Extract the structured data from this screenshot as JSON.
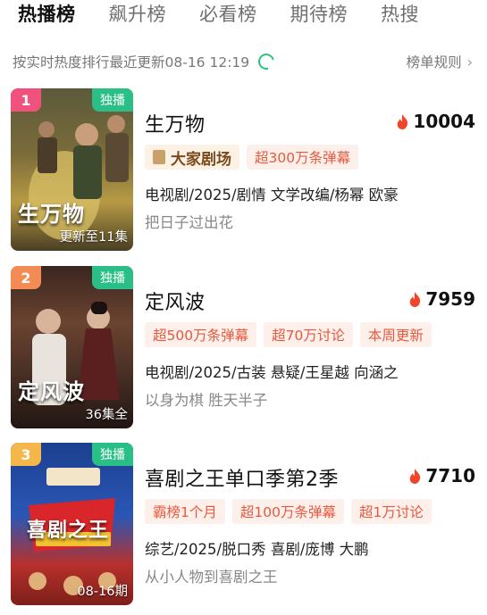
{
  "tabs": [
    "热播榜",
    "飙升榜",
    "必看榜",
    "期待榜",
    "热搜"
  ],
  "update_text": "按实时热度排行最近更新08-16 12:19",
  "rules_label": "榜单规则",
  "accent_color": "#2bbf88",
  "items": [
    {
      "rank": "1",
      "rank_color": "#f0517d",
      "exclusive": "独播",
      "poster_title": "生万物",
      "episode": "更新至11集",
      "title": "生万物",
      "heat": "10004",
      "brand_tag": "大家剧场",
      "tags": [
        "超300万条弹幕"
      ],
      "meta": "电视剧/2025/剧情 文学改编/杨幂 欧豪",
      "slogan": "把日子过出花"
    },
    {
      "rank": "2",
      "rank_color": "#f58b54",
      "exclusive": "独播",
      "poster_title": "定风波",
      "episode": "36集全",
      "title": "定风波",
      "heat": "7959",
      "tags": [
        "超500万条弹幕",
        "超70万讨论",
        "本周更新"
      ],
      "meta": "电视剧/2025/古装 悬疑/王星越 向涵之",
      "slogan": "以身为棋 胜天半子"
    },
    {
      "rank": "3",
      "rank_color": "#f5b64a",
      "exclusive": "独播",
      "poster_title": "喜剧之王",
      "episode": "08-16期",
      "title": "喜剧之王单口季第2季",
      "heat": "7710",
      "tags": [
        "霸榜1个月",
        "超100万条弹幕",
        "超1万讨论"
      ],
      "meta": "综艺/2025/脱口秀 喜剧/庞博 大鹏",
      "slogan": "从小人物到喜剧之王"
    }
  ]
}
